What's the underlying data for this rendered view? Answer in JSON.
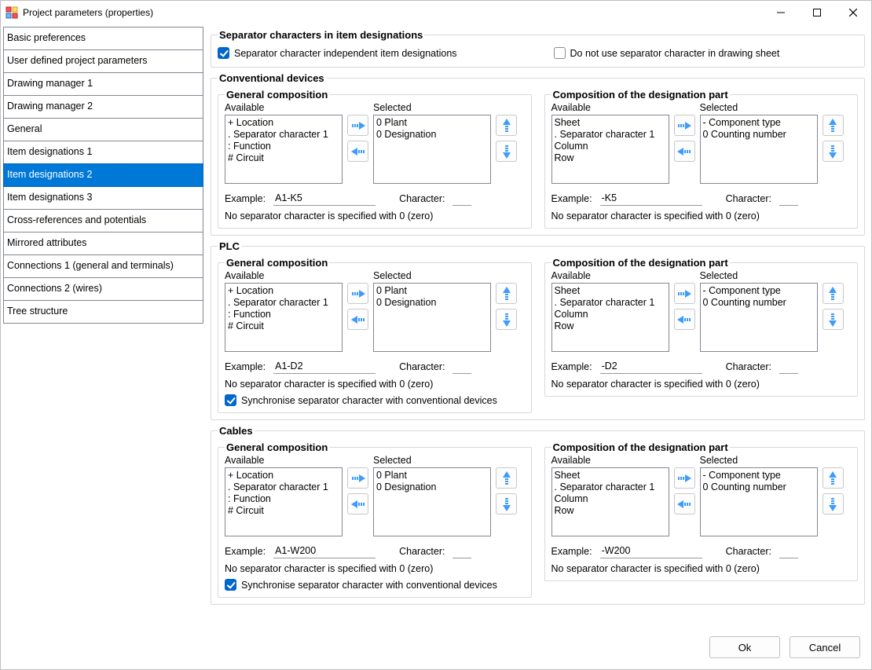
{
  "window": {
    "title": "Project parameters (properties)"
  },
  "sidebar": {
    "items": [
      "Basic preferences",
      "User defined project parameters",
      "Drawing manager 1",
      "Drawing manager 2",
      "General",
      "Item designations 1",
      "Item designations 2",
      "Item designations 3",
      "Cross-references and potentials",
      "Mirrored attributes",
      "Connections 1 (general and terminals)",
      "Connections 2 (wires)",
      "Tree structure"
    ],
    "selected_index": 6
  },
  "labels": {
    "available": "Available",
    "selected": "Selected",
    "example": "Example:",
    "character": "Character:",
    "note_zero": "No separator character is specified with 0 (zero)",
    "sync": "Synchronise separator character with conventional devices",
    "gen_comp": "General composition",
    "comp_part": "Composition of the designation part"
  },
  "sep_group": {
    "title": "Separator characters in item designations",
    "independent_label": "Separator character independent item designations",
    "independent_checked": true,
    "nouse_label": "Do not use separator character in drawing sheet",
    "nouse_checked": false
  },
  "gen_available": [
    "+ Location",
    ". Separator character 1",
    ": Function",
    "# Circuit"
  ],
  "gen_selected": [
    "0 Plant",
    "0 Designation"
  ],
  "part_available": [
    "Sheet",
    ". Separator character 1",
    "Column",
    "Row"
  ],
  "part_selected": [
    "- Component type",
    "0 Counting number"
  ],
  "groups": {
    "conventional": {
      "title": "Conventional devices",
      "gen_example": "A1-K5",
      "part_example": "-K5",
      "has_sync": false
    },
    "plc": {
      "title": "PLC",
      "gen_example": "A1-D2",
      "part_example": "-D2",
      "has_sync": true,
      "sync_checked": true
    },
    "cables": {
      "title": "Cables",
      "gen_example": "A1-W200",
      "part_example": "-W200",
      "has_sync": true,
      "sync_checked": true
    }
  },
  "footer": {
    "ok": "Ok",
    "cancel": "Cancel"
  }
}
